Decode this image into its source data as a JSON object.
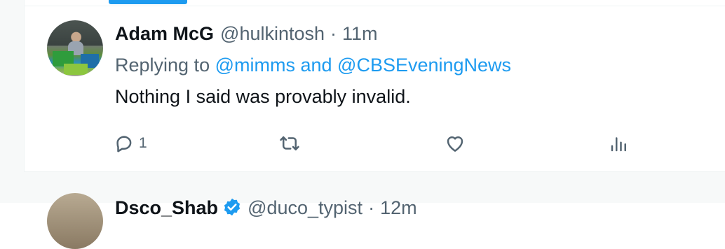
{
  "tweet": {
    "author_name": "Adam McG",
    "author_handle": "@hulkintosh",
    "separator": "·",
    "timestamp": "11m",
    "replying_prefix": "Replying to",
    "replying_to": "@mimms and @CBSEveningNews",
    "text": "Nothing I said was provably invalid.",
    "actions": {
      "reply_count": "1",
      "retweet_count": "",
      "like_count": "",
      "views_count": ""
    }
  },
  "next_tweet": {
    "author_name": "Dsco_Shab",
    "author_handle": "@duco_typist",
    "separator": "·",
    "timestamp": "12m"
  },
  "colors": {
    "accent": "#1d9bf0",
    "text_primary": "#0f1419",
    "text_secondary": "#536471",
    "divider": "#eff3f4"
  },
  "icons": {
    "reply": "speech-bubble-icon",
    "retweet": "retweet-arrows-icon",
    "like": "heart-icon",
    "views": "bar-chart-icon",
    "verified": "verified-badge-icon"
  }
}
